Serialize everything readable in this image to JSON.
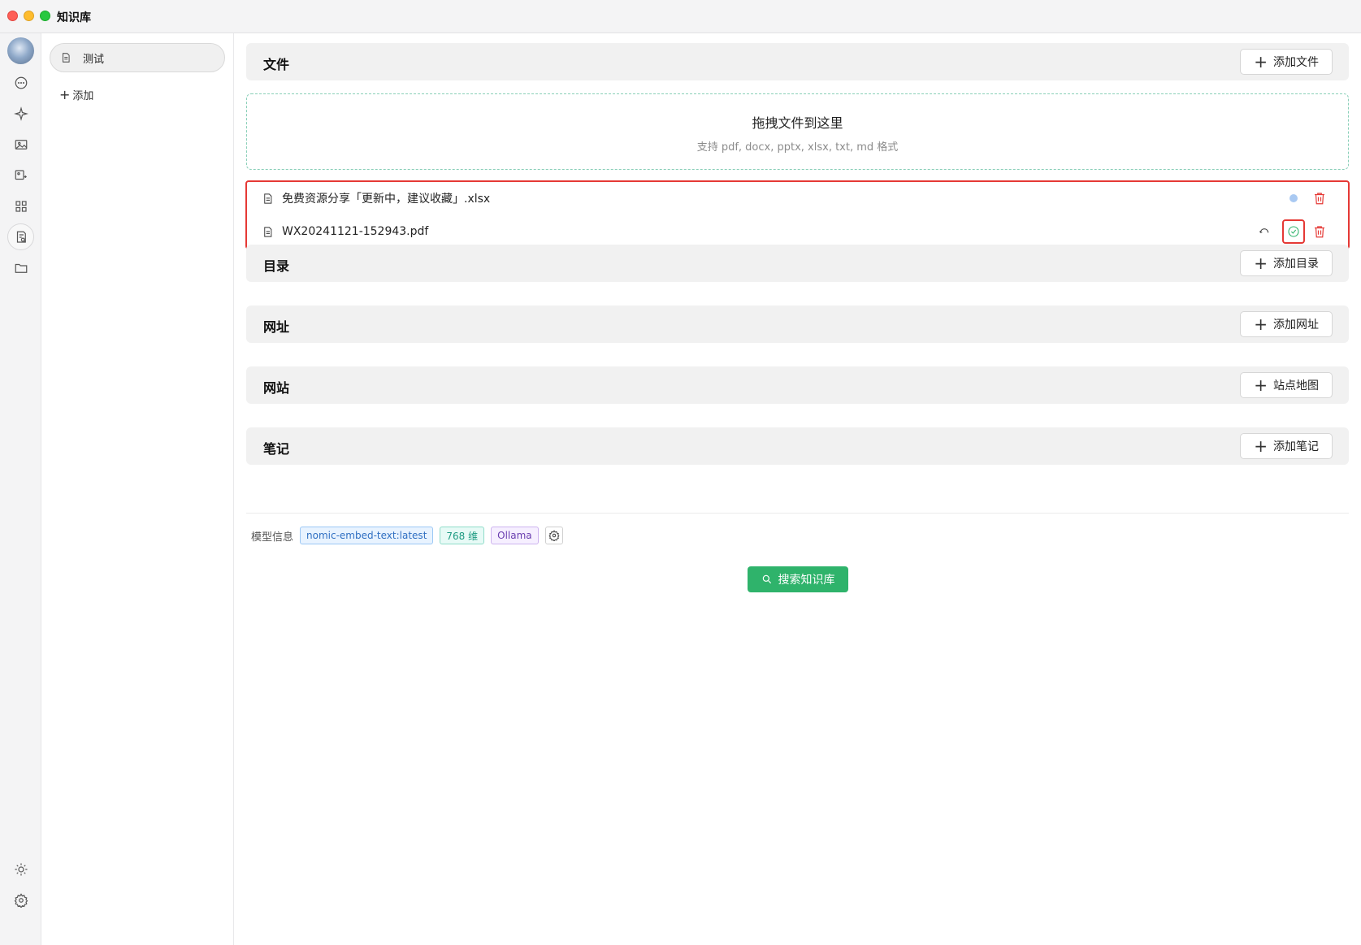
{
  "window": {
    "title": "知识库"
  },
  "sidebar": {
    "knowledge_bases": [
      {
        "name": "测试"
      }
    ],
    "add_label": "添加"
  },
  "rail": {
    "icons": [
      "avatar",
      "chat-icon",
      "sparkle-icon",
      "image-icon",
      "image-agent-icon",
      "apps-icon",
      "knowledge-icon",
      "folder-icon",
      "sun-icon",
      "settings-icon"
    ]
  },
  "sections": {
    "files": {
      "title": "文件",
      "add_label": "添加文件"
    },
    "directories": {
      "title": "目录",
      "add_label": "添加目录"
    },
    "urls": {
      "title": "网址",
      "add_label": "添加网址"
    },
    "websites": {
      "title": "网站",
      "add_label": "站点地图"
    },
    "notes": {
      "title": "笔记",
      "add_label": "添加笔记"
    }
  },
  "dropzone": {
    "title": "拖拽文件到这里",
    "subtitle": "支持 pdf, docx, pptx, xlsx, txt, md 格式"
  },
  "files": [
    {
      "name": "免费资源分享「更新中，建议收藏」.xlsx",
      "status": "pending"
    },
    {
      "name": "WX20241121-152943.pdf",
      "status": "done"
    }
  ],
  "model_info": {
    "label": "模型信息",
    "model": "nomic-embed-text:latest",
    "dimensions": "768 维",
    "provider": "Ollama"
  },
  "search_button": {
    "label": "搜索知识库"
  },
  "colors": {
    "accent": "#2fb36b",
    "danger": "#e53935",
    "pending": "#a9c9f2"
  }
}
